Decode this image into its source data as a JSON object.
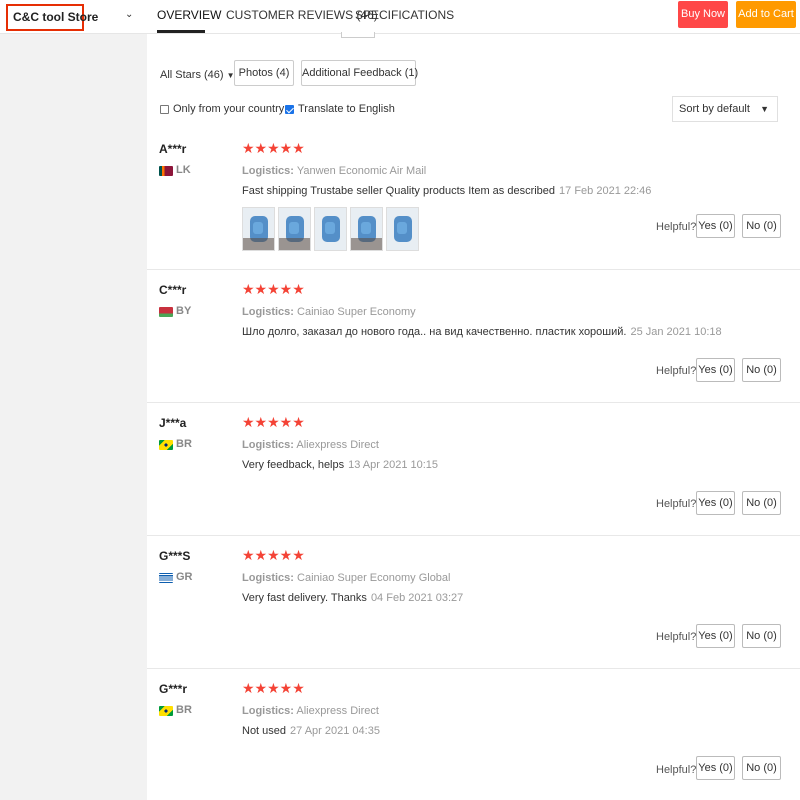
{
  "store": {
    "name": "C&C tool Store"
  },
  "tabs": [
    {
      "label": "OVERVIEW"
    },
    {
      "label": "CUSTOMER REVIEWS (46)"
    },
    {
      "label": "SPECIFICATIONS"
    }
  ],
  "actions": {
    "buy_now": "Buy Now",
    "add_to_cart": "Add to Cart"
  },
  "filters": {
    "all_stars": "All Stars (46)",
    "photos": "Photos (4)",
    "additional": "Additional Feedback (1)",
    "only_country": "Only from your country",
    "translate": "Translate to English",
    "sort": "Sort by default"
  },
  "common": {
    "logistics_label": "Logistics:",
    "helpful": "Helpful?",
    "stars": "★★★★★"
  },
  "reviews": [
    {
      "name": "A***r",
      "country": "LK",
      "logistics": "Yanwen Economic Air Mail",
      "text": "Fast shipping Trustabe seller Quality products Item as described",
      "date": "17 Feb 2021 22:46",
      "yes": "Yes (0)",
      "no": "No (0)"
    },
    {
      "name": "C***r",
      "country": "BY",
      "logistics": "Cainiao Super Economy",
      "text": "Шло долго, заказал до нового года.. на вид качественно. пластик хороший.",
      "date": "25 Jan 2021 10:18",
      "yes": "Yes (0)",
      "no": "No (0)"
    },
    {
      "name": "J***a",
      "country": "BR",
      "logistics": "Aliexpress Direct",
      "text": "Very feedback, helps",
      "date": "13 Apr 2021 10:15",
      "yes": "Yes (0)",
      "no": "No (0)"
    },
    {
      "name": "G***S",
      "country": "GR",
      "logistics": "Cainiao Super Economy Global",
      "text": "Very fast delivery. Thanks",
      "date": "04 Feb 2021 03:27",
      "yes": "Yes (0)",
      "no": "No (0)"
    },
    {
      "name": "G***r",
      "country": "BR",
      "logistics": "Aliexpress Direct",
      "text": "Not used",
      "date": "27 Apr 2021 04:35",
      "yes": "Yes (0)",
      "no": "No (0)"
    }
  ],
  "colors": {
    "buy": "#ff4747",
    "cart": "#ff9a00",
    "star": "#f44336",
    "store_border": "#e62e04"
  }
}
